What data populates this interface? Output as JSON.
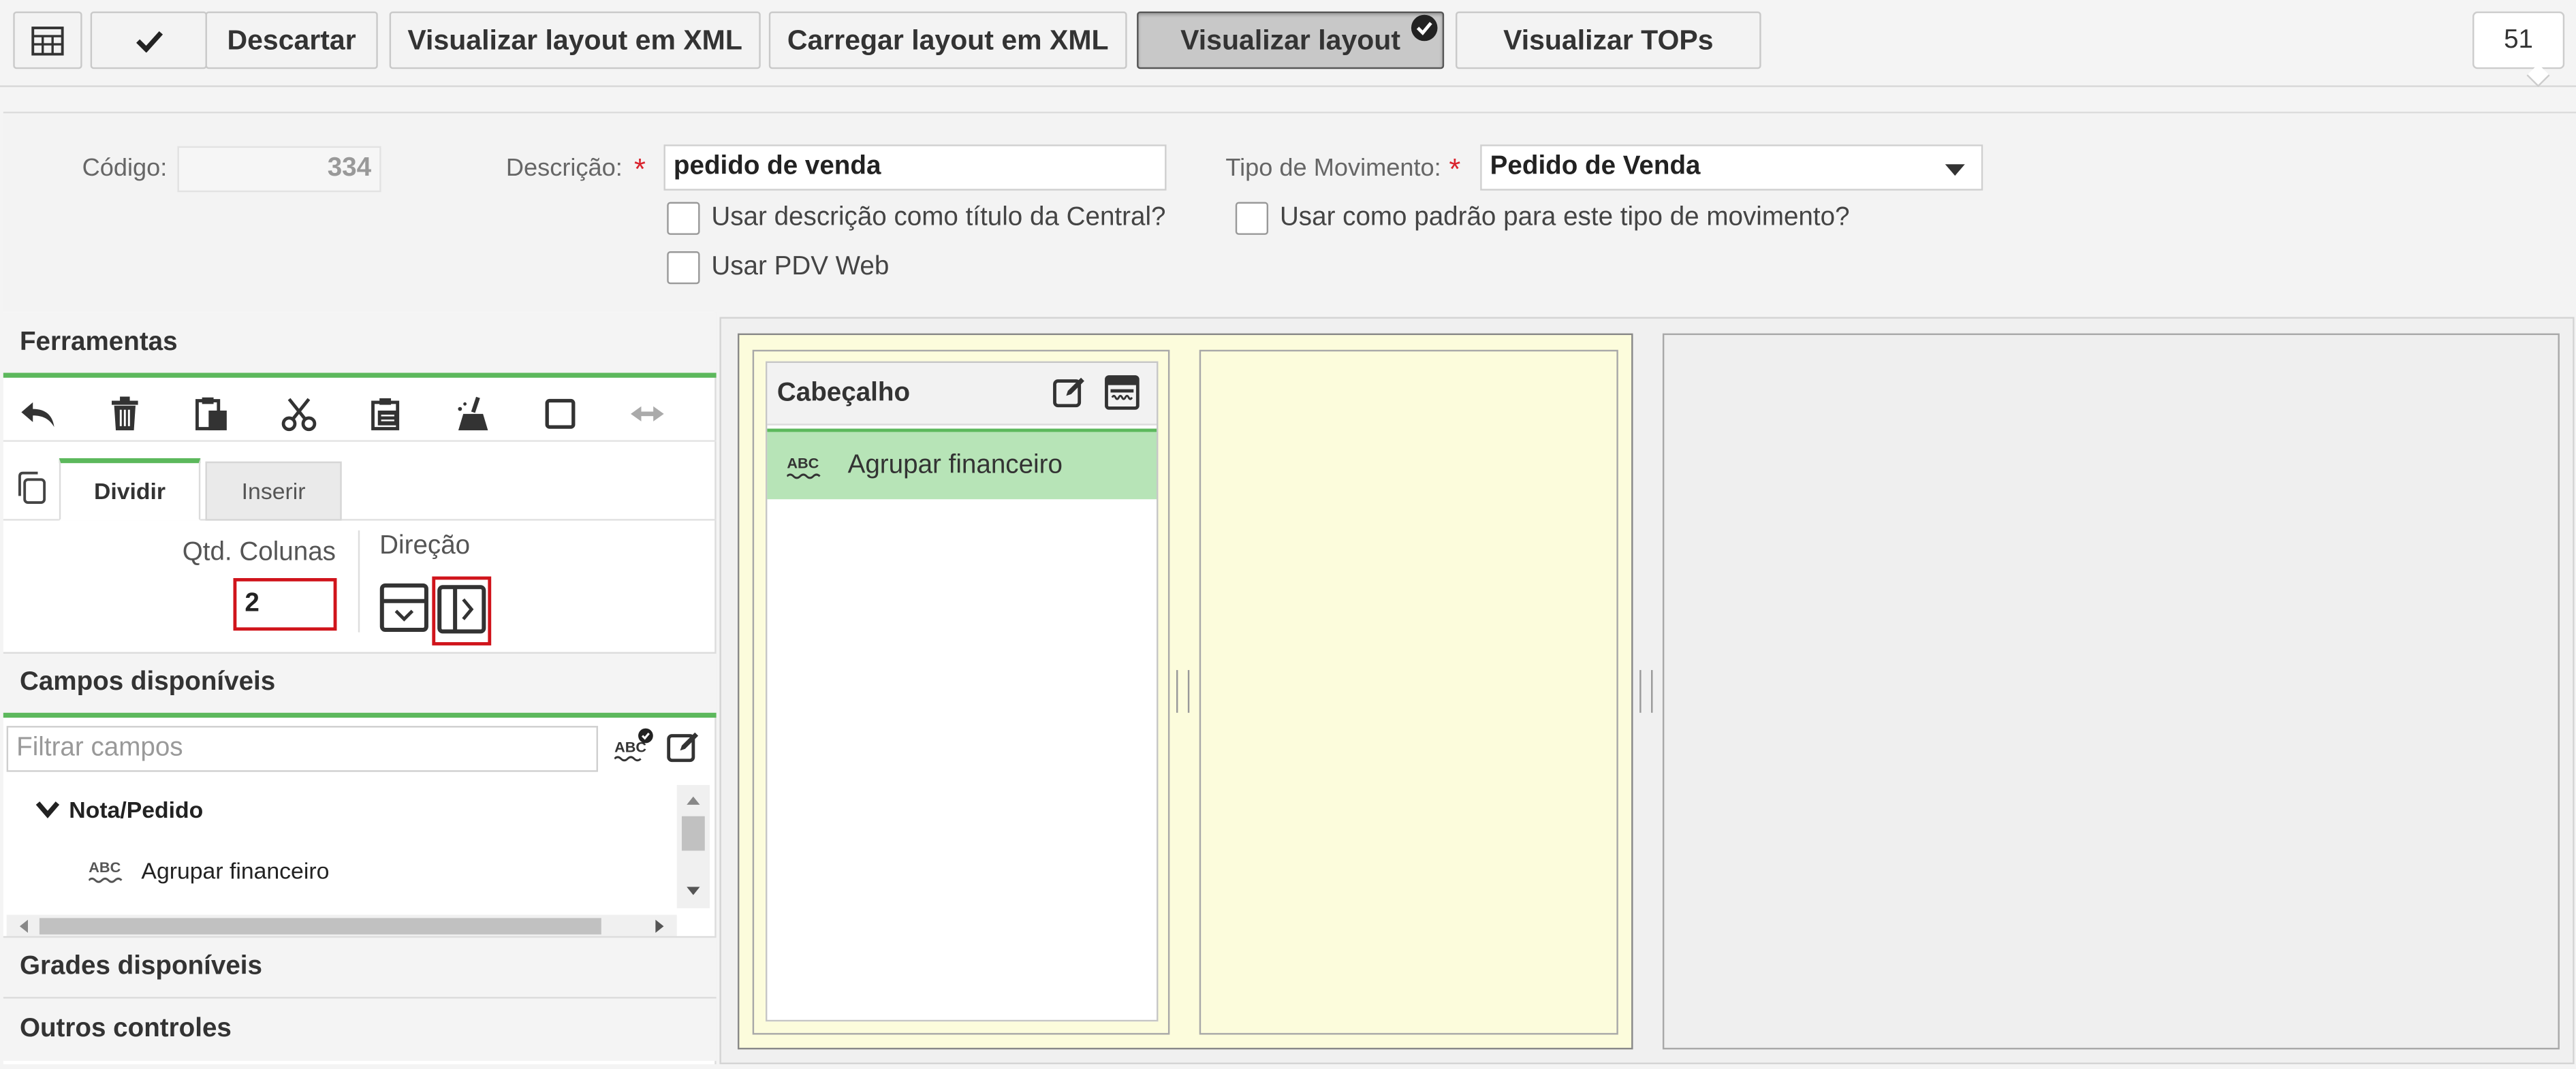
{
  "toolbar": {
    "grid_icon": "grid-icon",
    "check_icon": "check-icon",
    "discard_label": "Descartar",
    "view_xml_label": "Visualizar layout em XML",
    "load_xml_label": "Carregar layout em XML",
    "view_layout_label": "Visualizar layout",
    "view_tops_label": "Visualizar TOPs",
    "counter": "51"
  },
  "form": {
    "code_label": "Código:",
    "code_value": "334",
    "description_label": "Descrição:",
    "description_value": "pedido de venda",
    "movement_type_label": "Tipo de Movimento:",
    "movement_type_value": "Pedido de Venda",
    "required_mark": "*",
    "cb_use_description_title": "Usar descrição como título da Central?",
    "cb_use_default": "Usar como padrão para este tipo de movimento?",
    "cb_use_pdv_web": "Usar PDV Web"
  },
  "tools": {
    "title": "Ferramentas",
    "icons": [
      "undo-icon",
      "trash-icon",
      "paste-icon",
      "cut-icon",
      "clipboard-icon",
      "broom-icon",
      "square-icon",
      "swap-arrows-icon"
    ],
    "copy_icon": "copy-icon",
    "tab_divide": "Dividir",
    "tab_insert": "Inserir",
    "qty_columns_label": "Qtd. Colunas",
    "qty_columns_value": "2",
    "direction_label": "Direção"
  },
  "fields": {
    "title": "Campos disponíveis",
    "filter_placeholder": "Filtrar campos",
    "group": "Nota/Pedido",
    "items": [
      "Agrupar financeiro"
    ]
  },
  "grids_title": "Grades disponíveis",
  "other_controls_title": "Outros controles",
  "canvas": {
    "card_title": "Cabeçalho",
    "card_item": "Agrupar financeiro",
    "abc_text": "ABC"
  }
}
